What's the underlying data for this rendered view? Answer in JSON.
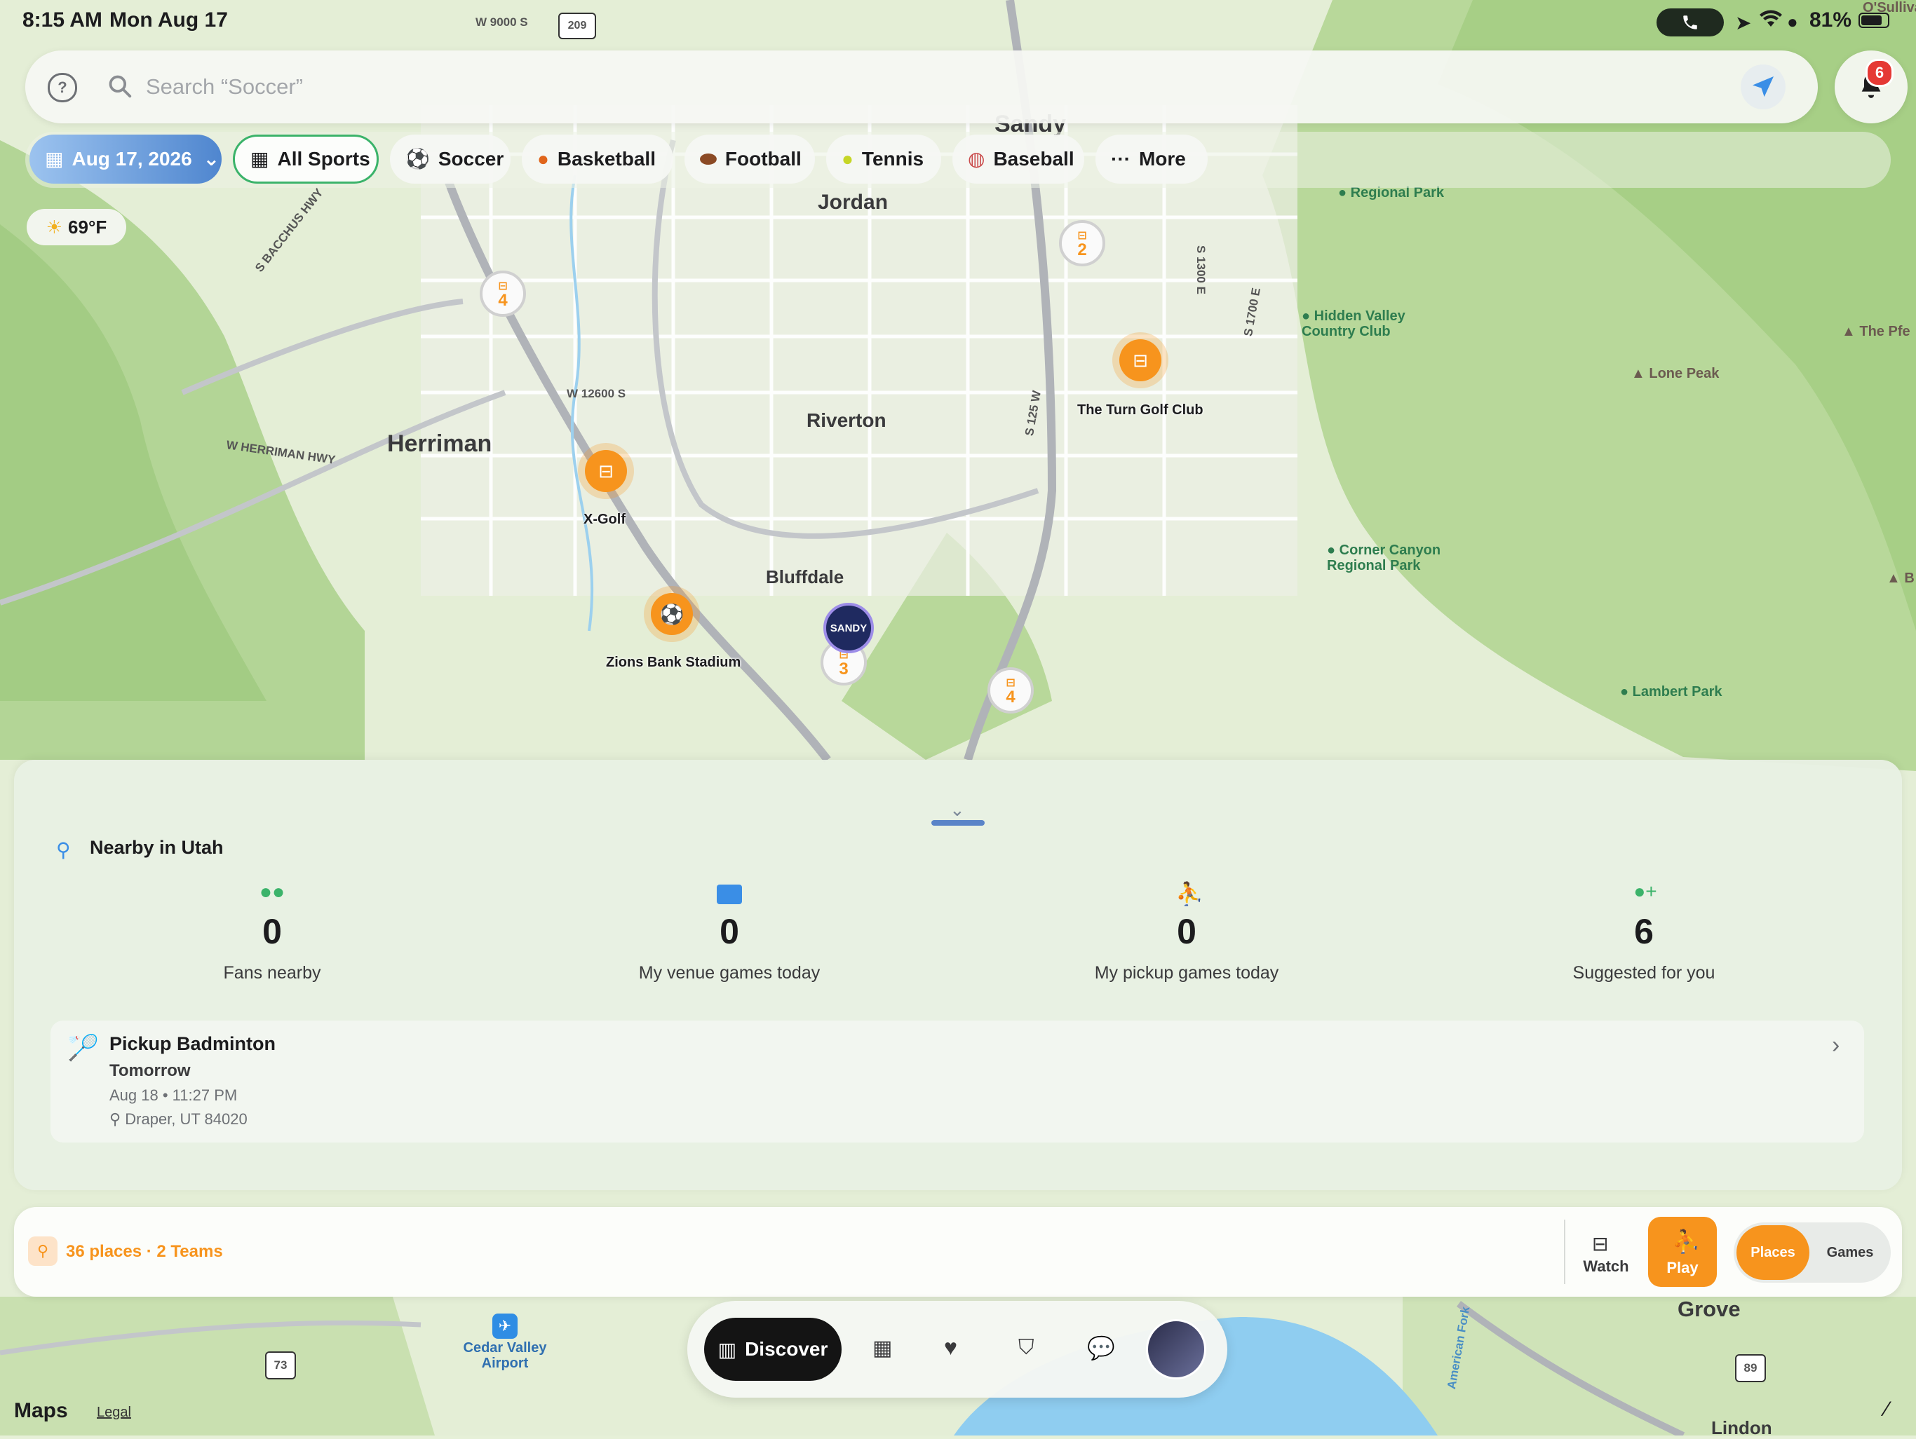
{
  "status_bar": {
    "time": "8:15 AM",
    "date": "Mon Aug 17",
    "battery": "81%"
  },
  "search": {
    "placeholder": "Search “Soccer”"
  },
  "notifications": {
    "count": "6"
  },
  "filters": {
    "date": "Aug 17, 2026",
    "chips": [
      "All Sports",
      "Soccer",
      "Basketball",
      "Football",
      "Tennis",
      "Baseball",
      "More"
    ]
  },
  "weather": {
    "temp": "69°F"
  },
  "map": {
    "cities": [
      "Jordan",
      "Herriman",
      "Riverton",
      "Bluffdale",
      "Sandy",
      "Grove",
      "Lindon"
    ],
    "roads": [
      "W 9000 S",
      "209",
      "S BACCHUS HWY",
      "W 12600 S",
      "W HERRIMAN HWY",
      "S 125 W",
      "S 1300 E",
      "S 1700 E",
      "73",
      "89",
      "American Fork"
    ],
    "parks": [
      "Regional Park",
      "Hidden Valley Country Club",
      "Corner Canyon Regional Park",
      "Lambert Park"
    ],
    "peaks": [
      "Lone Peak",
      "The Pfe",
      "O'Sullivan",
      "B"
    ],
    "venues": [
      "The Turn Golf Club",
      "X-Golf",
      "Zions Bank Stadium"
    ],
    "clusters": [
      "4",
      "2",
      "3",
      "4"
    ],
    "airport": "Cedar Valley Airport",
    "team_badge": "SANDY",
    "attribution": "Maps",
    "legal": "Legal"
  },
  "sheet": {
    "title": "Nearby in Utah",
    "stats": [
      {
        "value": "0",
        "label": "Fans nearby"
      },
      {
        "value": "0",
        "label": "My venue games today"
      },
      {
        "value": "0",
        "label": "My pickup games today"
      },
      {
        "value": "6",
        "label": "Suggested for you"
      }
    ],
    "game": {
      "title": "Pickup Badminton",
      "when": "Tomorrow",
      "datetime": "Aug 18 • 11:27 PM",
      "location": "Draper, UT 84020"
    }
  },
  "bottom_bar": {
    "summary": "36 places · 2 Teams",
    "watch": "Watch",
    "play": "Play",
    "segment": [
      "Places",
      "Games"
    ]
  },
  "tab_bar": {
    "discover": "Discover"
  },
  "colors": {
    "accent_orange": "#f7941d",
    "accent_blue": "#4f86cf",
    "accent_green": "#3bb36a"
  }
}
